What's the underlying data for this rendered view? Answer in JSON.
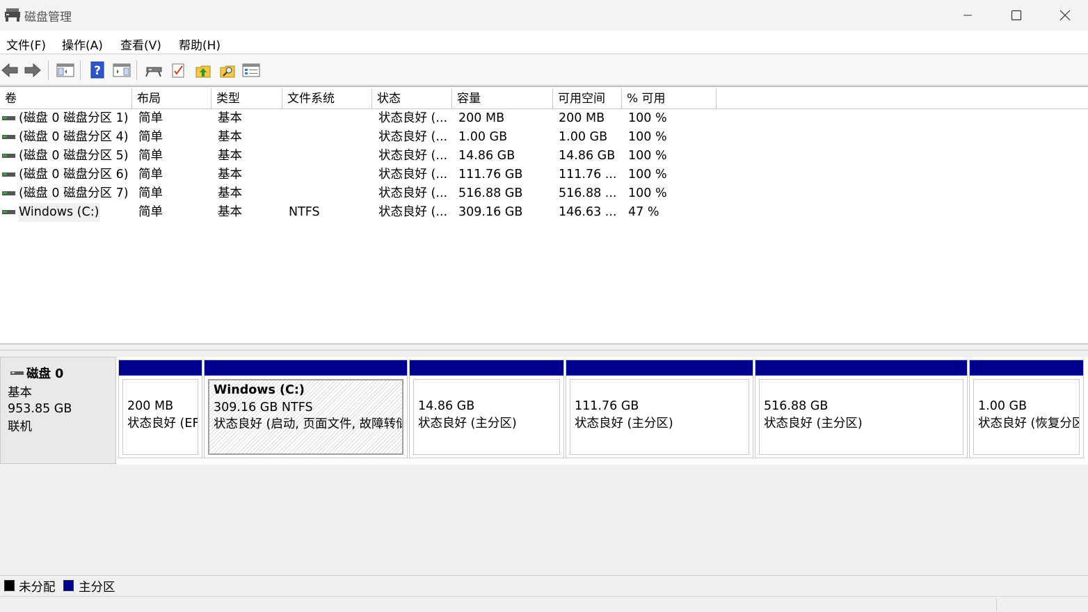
{
  "window": {
    "title": "磁盘管理"
  },
  "menu": {
    "items": [
      "文件(F)",
      "操作(A)",
      "查看(V)",
      "帮助(H)"
    ]
  },
  "toolbar": {
    "buttons": [
      "back-icon",
      "forward-icon",
      "console-tree-icon",
      "help-icon",
      "action-pane-icon",
      "disk-connect-icon",
      "checklist-icon",
      "up-arrow-folder-icon",
      "search-folder-icon",
      "properties-icon"
    ]
  },
  "volume_table": {
    "columns": [
      "卷",
      "布局",
      "类型",
      "文件系统",
      "状态",
      "容量",
      "可用空间",
      "% 可用"
    ],
    "rows": [
      {
        "volume": "(磁盘 0 磁盘分区 1)",
        "layout": "简单",
        "type": "基本",
        "fs": "",
        "status": "状态良好 (...",
        "capacity": "200 MB",
        "free": "200 MB",
        "pct": "100 %"
      },
      {
        "volume": "(磁盘 0 磁盘分区 4)",
        "layout": "简单",
        "type": "基本",
        "fs": "",
        "status": "状态良好 (...",
        "capacity": "1.00 GB",
        "free": "1.00 GB",
        "pct": "100 %"
      },
      {
        "volume": "(磁盘 0 磁盘分区 5)",
        "layout": "简单",
        "type": "基本",
        "fs": "",
        "status": "状态良好 (...",
        "capacity": "14.86 GB",
        "free": "14.86 GB",
        "pct": "100 %"
      },
      {
        "volume": "(磁盘 0 磁盘分区 6)",
        "layout": "简单",
        "type": "基本",
        "fs": "",
        "status": "状态良好 (...",
        "capacity": "111.76 GB",
        "free": "111.76 ...",
        "pct": "100 %"
      },
      {
        "volume": "(磁盘 0 磁盘分区 7)",
        "layout": "简单",
        "type": "基本",
        "fs": "",
        "status": "状态良好 (...",
        "capacity": "516.88 GB",
        "free": "516.88 ...",
        "pct": "100 %"
      },
      {
        "volume": "Windows (C:)",
        "layout": "简单",
        "type": "基本",
        "fs": "NTFS",
        "status": "状态良好 (...",
        "capacity": "309.16 GB",
        "free": "146.63 ...",
        "pct": "47 %"
      }
    ]
  },
  "disk": {
    "name": "磁盘 0",
    "type": "基本",
    "size": "953.85 GB",
    "state": "联机"
  },
  "partitions": [
    {
      "title": "",
      "size": "200 MB",
      "status": "状态良好 (EFI 系统分区)",
      "selected": false
    },
    {
      "title": "Windows  (C:)",
      "size": "309.16 GB NTFS",
      "status": "状态良好 (启动, 页面文件, 故障转储, 基本数据分区)",
      "selected": true
    },
    {
      "title": "",
      "size": "14.86 GB",
      "status": "状态良好 (主分区)",
      "selected": false
    },
    {
      "title": "",
      "size": "111.76 GB",
      "status": "状态良好 (主分区)",
      "selected": false
    },
    {
      "title": "",
      "size": "516.88 GB",
      "status": "状态良好 (主分区)",
      "selected": false
    },
    {
      "title": "",
      "size": "1.00 GB",
      "status": "状态良好 (恢复分区)",
      "selected": false
    }
  ],
  "legend": [
    {
      "label": "未分配",
      "color": "#000000"
    },
    {
      "label": "主分区",
      "color": "#00008f"
    }
  ],
  "colors": {
    "primary_partition": "#00008f",
    "unallocated": "#000000"
  }
}
